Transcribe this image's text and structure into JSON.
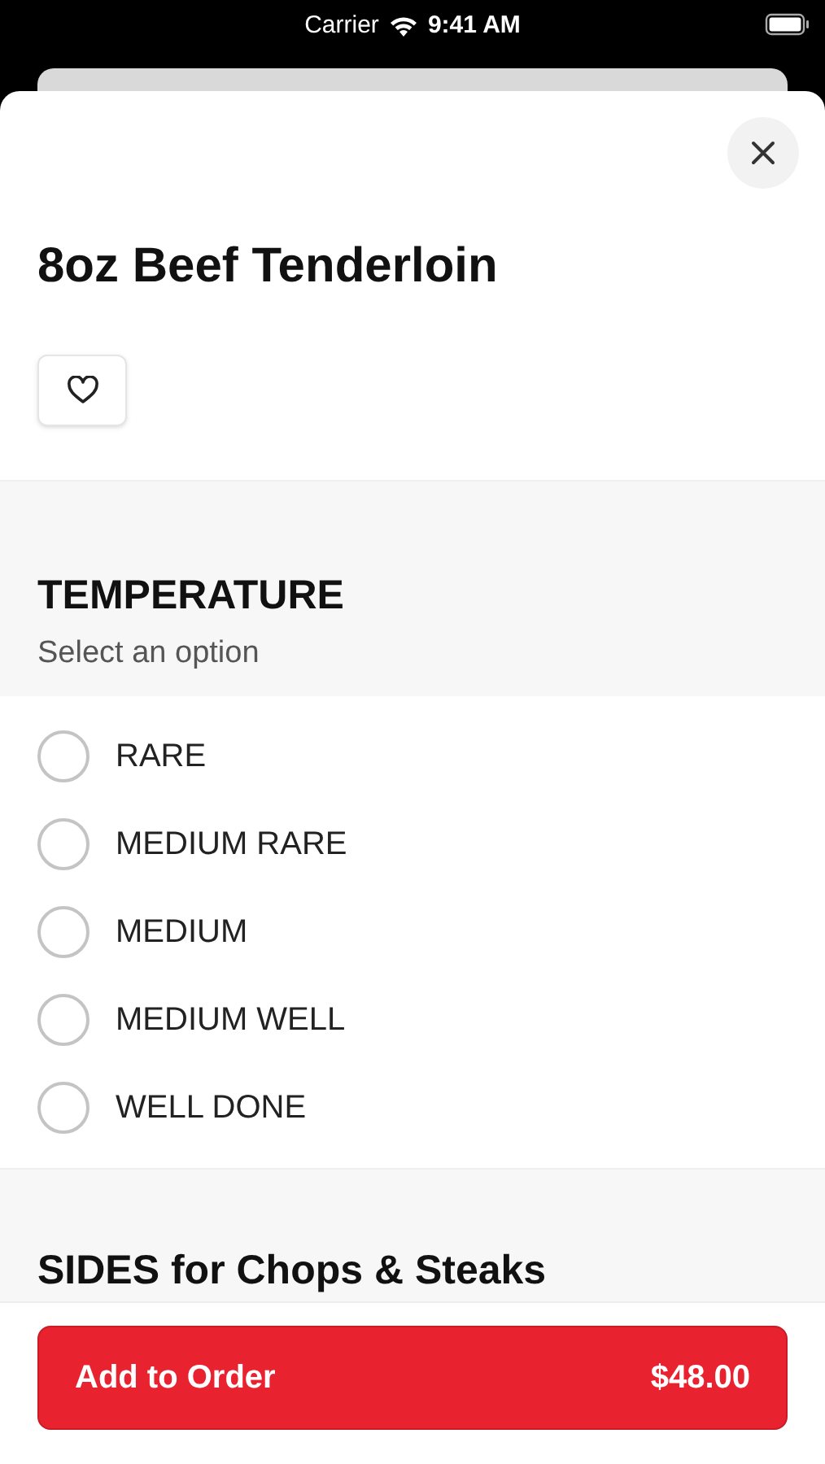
{
  "status_bar": {
    "carrier": "Carrier",
    "time": "9:41 AM"
  },
  "item": {
    "title": "8oz Beef Tenderloin"
  },
  "sections": [
    {
      "heading": "TEMPERATURE",
      "subtitle": "Select an option",
      "options": [
        {
          "label": "RARE",
          "selected": false
        },
        {
          "label": "MEDIUM RARE",
          "selected": false
        },
        {
          "label": "MEDIUM",
          "selected": false
        },
        {
          "label": "MEDIUM WELL",
          "selected": false
        },
        {
          "label": "WELL DONE",
          "selected": false
        }
      ]
    },
    {
      "heading": "SIDES for Chops & Steaks"
    }
  ],
  "footer": {
    "button_label": "Add to Order",
    "price": "$48.00"
  }
}
